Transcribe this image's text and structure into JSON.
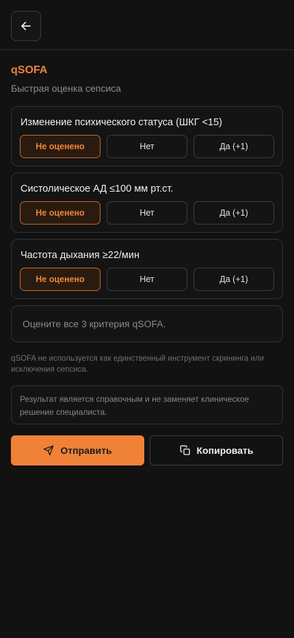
{
  "header": {
    "back_icon": "arrow-left-icon"
  },
  "page": {
    "title": "qSOFA",
    "subtitle": "Быстрая оценка сепсиса"
  },
  "criteria": [
    {
      "label": "Изменение психического статуса (ШКГ <15)",
      "options": [
        "Не оценено",
        "Нет",
        "Да (+1)"
      ],
      "selected": 0
    },
    {
      "label": "Систолическое АД ≤100 мм рт.ст.",
      "options": [
        "Не оценено",
        "Нет",
        "Да (+1)"
      ],
      "selected": 0
    },
    {
      "label": "Частота дыхания ≥22/мин",
      "options": [
        "Не оценено",
        "Нет",
        "Да (+1)"
      ],
      "selected": 0
    }
  ],
  "result": {
    "text": "Оцените все 3 критерия qSOFA."
  },
  "note": "qSOFA не используется как единственный инструмент скрининга или исключения сепсиса.",
  "disclaimer": "Результат является справочным и не заменяет клиническое решение специалиста.",
  "actions": {
    "send_label": "Отправить",
    "send_icon": "send-icon",
    "copy_label": "Копировать",
    "copy_icon": "copy-icon"
  },
  "colors": {
    "accent": "#ef8237",
    "background": "#121212",
    "border": "#343434"
  }
}
